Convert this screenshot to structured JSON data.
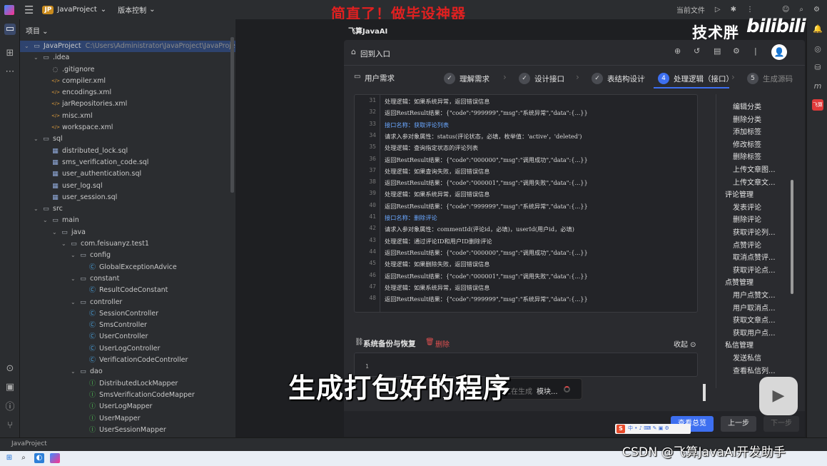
{
  "colors": {
    "accent": "#3d6ff0",
    "banner": "#e02020",
    "danger": "#e05050"
  },
  "topbar": {
    "project_badge": "JP",
    "project_name": "JavaProject",
    "vcs_label": "版本控制",
    "current_file": "当前文件"
  },
  "overlay": {
    "banner_title": "简直了！做毕设神器",
    "brand_text": "技术胖",
    "bili_text": "bilibili",
    "subtitle": "生成打包好的程序",
    "watermark": "CSDN @飞算JavaAI开发助手"
  },
  "project_panel": {
    "header": "项目",
    "tree": [
      {
        "label": "JavaProject",
        "path": "C:\\Users\\Administrator\\JavaProject\\JavaProject",
        "indent": 0,
        "chev": "v",
        "icon": "folder",
        "selected": true
      },
      {
        "label": ".idea",
        "indent": 1,
        "chev": "v",
        "icon": "folder"
      },
      {
        "label": ".gitignore",
        "indent": 2,
        "icon": "file"
      },
      {
        "label": "compiler.xml",
        "indent": 2,
        "icon": "xml"
      },
      {
        "label": "encodings.xml",
        "indent": 2,
        "icon": "xml"
      },
      {
        "label": "jarRepositories.xml",
        "indent": 2,
        "icon": "xml"
      },
      {
        "label": "misc.xml",
        "indent": 2,
        "icon": "xml"
      },
      {
        "label": "workspace.xml",
        "indent": 2,
        "icon": "xml"
      },
      {
        "label": "sql",
        "indent": 1,
        "chev": "v",
        "icon": "folder"
      },
      {
        "label": "distributed_lock.sql",
        "indent": 2,
        "icon": "sql"
      },
      {
        "label": "sms_verification_code.sql",
        "indent": 2,
        "icon": "sql"
      },
      {
        "label": "user_authentication.sql",
        "indent": 2,
        "icon": "sql"
      },
      {
        "label": "user_log.sql",
        "indent": 2,
        "icon": "sql"
      },
      {
        "label": "user_session.sql",
        "indent": 2,
        "icon": "sql"
      },
      {
        "label": "src",
        "indent": 1,
        "chev": "v",
        "icon": "folder"
      },
      {
        "label": "main",
        "indent": 2,
        "chev": "v",
        "icon": "folder"
      },
      {
        "label": "java",
        "indent": 3,
        "chev": "v",
        "icon": "folder"
      },
      {
        "label": "com.feisuanyz.test1",
        "indent": 4,
        "chev": "v",
        "icon": "pkg"
      },
      {
        "label": "config",
        "indent": 5,
        "chev": "v",
        "icon": "pkg"
      },
      {
        "label": "GlobalExceptionAdvice",
        "indent": 6,
        "icon": "cls"
      },
      {
        "label": "constant",
        "indent": 5,
        "chev": "v",
        "icon": "pkg"
      },
      {
        "label": "ResultCodeConstant",
        "indent": 6,
        "icon": "cls"
      },
      {
        "label": "controller",
        "indent": 5,
        "chev": "v",
        "icon": "pkg"
      },
      {
        "label": "SessionController",
        "indent": 6,
        "icon": "cls"
      },
      {
        "label": "SmsController",
        "indent": 6,
        "icon": "cls"
      },
      {
        "label": "UserController",
        "indent": 6,
        "icon": "cls"
      },
      {
        "label": "UserLogController",
        "indent": 6,
        "icon": "cls"
      },
      {
        "label": "VerificationCodeController",
        "indent": 6,
        "icon": "cls"
      },
      {
        "label": "dao",
        "indent": 5,
        "chev": "v",
        "icon": "pkg"
      },
      {
        "label": "DistributedLockMapper",
        "indent": 6,
        "icon": "intf"
      },
      {
        "label": "SmsVerificationCodeMapper",
        "indent": 6,
        "icon": "intf"
      },
      {
        "label": "UserLogMapper",
        "indent": 6,
        "icon": "intf"
      },
      {
        "label": "UserMapper",
        "indent": 6,
        "icon": "intf"
      },
      {
        "label": "UserSessionMapper",
        "indent": 6,
        "icon": "intf"
      }
    ]
  },
  "status": {
    "breadcrumb": "JavaProject"
  },
  "plugin": {
    "title": "飞算JavaAI",
    "back_label": "回到入口",
    "req_label": "用户需求",
    "steps": [
      {
        "num": "✓",
        "label": "理解需求",
        "state": "done"
      },
      {
        "num": "✓",
        "label": "设计接口",
        "state": "done"
      },
      {
        "num": "✓",
        "label": "表结构设计",
        "state": "done"
      },
      {
        "num": "4",
        "label": "处理逻辑（接口）",
        "state": "active"
      },
      {
        "num": "5",
        "label": "生成源码",
        "state": "todo"
      }
    ],
    "code_lines": [
      {
        "n": "31",
        "t": "处理逻辑：如果系统异常，返回错误信息",
        "hl": false
      },
      {
        "n": "32",
        "t": "返回RestResult结果：{\"code\":\"999999\",\"msg\":\"系统异常\",\"data\":{...}}",
        "hl": false
      },
      {
        "n": "33",
        "t": "接口名称：获取评论列表",
        "hl": true
      },
      {
        "n": "34",
        "t": "请求入参对象属性：status(评论状态，必填，枚举值：'active'，'deleted')",
        "hl": false
      },
      {
        "n": "35",
        "t": "处理逻辑：查询指定状态的评论列表",
        "hl": false
      },
      {
        "n": "36",
        "t": "返回RestResult结果：{\"code\":\"000000\",\"msg\":\"调用成功\",\"data\":{...}}",
        "hl": false
      },
      {
        "n": "37",
        "t": "处理逻辑：如果查询失败，返回错误信息",
        "hl": false
      },
      {
        "n": "38",
        "t": "返回RestResult结果：{\"code\":\"000001\",\"msg\":\"调用失败\",\"data\":{...}}",
        "hl": false
      },
      {
        "n": "39",
        "t": "处理逻辑：如果系统异常，返回错误信息",
        "hl": false
      },
      {
        "n": "40",
        "t": "返回RestResult结果：{\"code\":\"999999\",\"msg\":\"系统异常\",\"data\":{...}}",
        "hl": false
      },
      {
        "n": "41",
        "t": "接口名称：删除评论",
        "hl": true
      },
      {
        "n": "42",
        "t": "请求入参对象属性：commentId(评论id，必填)，userId(用户id，必填)",
        "hl": false
      },
      {
        "n": "43",
        "t": "处理逻辑：通过评论ID和用户ID删除评论",
        "hl": false
      },
      {
        "n": "44",
        "t": "返回RestResult结果：{\"code\":\"000000\",\"msg\":\"调用成功\",\"data\":{...}}",
        "hl": false
      },
      {
        "n": "45",
        "t": "处理逻辑：如果删除失败，返回错误信息",
        "hl": false
      },
      {
        "n": "46",
        "t": "返回RestResult结果：{\"code\":\"000001\",\"msg\":\"调用失败\",\"data\":{...}}",
        "hl": false
      },
      {
        "n": "47",
        "t": "处理逻辑：如果系统异常，返回错误信息",
        "hl": false
      },
      {
        "n": "48",
        "t": "返回RestResult结果：{\"code\":\"999999\",\"msg\":\"系统异常\",\"data\":{...}}",
        "hl": false
      }
    ],
    "categories": [
      {
        "t": "编辑分类",
        "g": false
      },
      {
        "t": "删除分类",
        "g": false
      },
      {
        "t": "添加标签",
        "g": false
      },
      {
        "t": "修改标签",
        "g": false
      },
      {
        "t": "删除标签",
        "g": false
      },
      {
        "t": "上传文章图...",
        "g": false
      },
      {
        "t": "上传文章文...",
        "g": false
      },
      {
        "t": "评论管理",
        "g": true
      },
      {
        "t": "发表评论",
        "g": false
      },
      {
        "t": "删除评论",
        "g": false
      },
      {
        "t": "获取评论列...",
        "g": false
      },
      {
        "t": "点赞评论",
        "g": false
      },
      {
        "t": "取消点赞评...",
        "g": false
      },
      {
        "t": "获取评论点...",
        "g": false
      },
      {
        "t": "点赞管理",
        "g": true
      },
      {
        "t": "用户点赞文...",
        "g": false
      },
      {
        "t": "用户取消点...",
        "g": false
      },
      {
        "t": "获取文章点...",
        "g": false
      },
      {
        "t": "获取用户点...",
        "g": false
      },
      {
        "t": "私信管理",
        "g": true
      },
      {
        "t": "发送私信",
        "g": false
      },
      {
        "t": "查看私信列...",
        "g": false
      }
    ],
    "backup": {
      "title": "系统备份与恢复",
      "delete_label": "删除",
      "collapse_label": "收起",
      "line_number": "1"
    },
    "toast": {
      "text": "模块...",
      "dim": "正在生成"
    },
    "buttons": {
      "view_summary": "查看总览",
      "prev": "上一步",
      "next": "下一步"
    }
  }
}
